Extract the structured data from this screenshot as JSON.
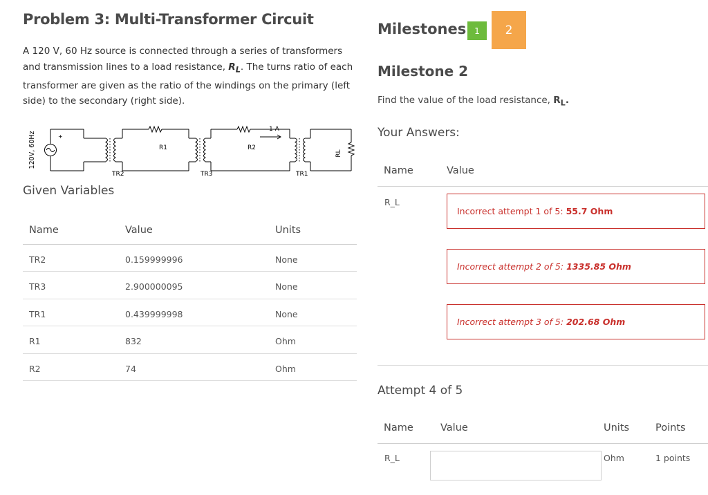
{
  "problem": {
    "title": "Problem 3: Multi-Transformer Circuit",
    "description_part1": "A 120 V, 60 Hz source is connected through a series of transformers and transmission lines to a load resistance, ",
    "description_symbol": "R",
    "description_symbol_sub": "L",
    "description_part2": ".  The turns ratio of each transformer are given as the ratio of the windings on the primary (left side) to the secondary (right side)."
  },
  "circuit": {
    "source_label": "120V, 60Hz",
    "labels": {
      "tr2": "TR2",
      "tr3": "TR3",
      "tr1": "TR1",
      "r1": "R1",
      "r2": "R2",
      "rl": "RL",
      "current": "1 A",
      "plus": "+"
    }
  },
  "given": {
    "title": "Given Variables",
    "headers": {
      "name": "Name",
      "value": "Value",
      "units": "Units"
    },
    "rows": [
      {
        "name": "TR2",
        "value": "0.159999996",
        "units": "None"
      },
      {
        "name": "TR3",
        "value": "2.900000095",
        "units": "None"
      },
      {
        "name": "TR1",
        "value": "0.439999998",
        "units": "None"
      },
      {
        "name": "R1",
        "value": "832",
        "units": "Ohm"
      },
      {
        "name": "R2",
        "value": "74",
        "units": "Ohm"
      }
    ]
  },
  "milestones": {
    "label": "Milestones:",
    "items": [
      {
        "label": "1",
        "color": "#6dbb3c",
        "state": "completed"
      },
      {
        "label": "2",
        "color": "#f5a64a",
        "state": "current"
      }
    ]
  },
  "milestone": {
    "title": "Milestone 2",
    "prompt": "Find the value of the load resistance, ",
    "prompt_symbol": "R",
    "prompt_symbol_sub": "L",
    "prompt_end": "."
  },
  "answers": {
    "title": "Your Answers:",
    "headers": {
      "name": "Name",
      "value": "Value"
    },
    "variable": "R_L",
    "attempts": [
      {
        "text": "Incorrect attempt 1 of 5:",
        "value": "55.7 Ohm",
        "italic": false
      },
      {
        "text": "Incorrect attempt 2 of 5:",
        "value": "1335.85 Ohm",
        "italic": true
      },
      {
        "text": "Incorrect attempt 3 of 5:",
        "value": "202.68 Ohm",
        "italic": true
      }
    ]
  },
  "attempt4": {
    "title": "Attempt 4 of 5",
    "headers": {
      "name": "Name",
      "value": "Value",
      "units": "Units",
      "points": "Points"
    },
    "variable": "R_L",
    "input_value": "",
    "units": "Ohm",
    "points": "1 points"
  },
  "colors": {
    "error": "#c9302c",
    "heading": "#4a4a4a",
    "milestone_done": "#6dbb3c",
    "milestone_current": "#f5a64a"
  }
}
